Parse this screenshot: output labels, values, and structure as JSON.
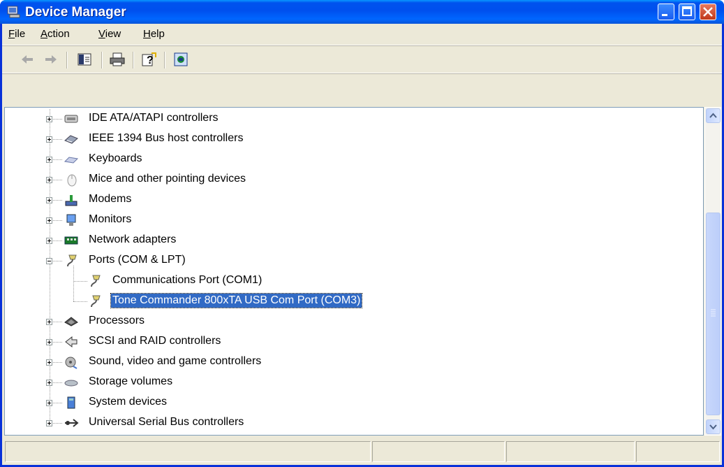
{
  "window": {
    "title": "Device Manager"
  },
  "menu": [
    {
      "label": "File",
      "u": "F",
      "rest": "ile"
    },
    {
      "label": "Action",
      "u": "A",
      "rest": "ction"
    },
    {
      "label": "View",
      "u": "V",
      "rest": "iew"
    },
    {
      "label": "Help",
      "u": "H",
      "rest": "elp"
    }
  ],
  "toolbar": {
    "buttons": [
      "back-icon",
      "forward-icon",
      "show-hide-tree-icon",
      "print-icon",
      "help-icon",
      "properties-icon"
    ]
  },
  "tree": {
    "items": [
      {
        "label": "IDE ATA/ATAPI controllers",
        "icon": "ide-controller-icon",
        "expanded": false
      },
      {
        "label": "IEEE 1394 Bus host controllers",
        "icon": "ieee1394-icon",
        "expanded": false
      },
      {
        "label": "Keyboards",
        "icon": "keyboard-icon",
        "expanded": false
      },
      {
        "label": "Mice and other pointing devices",
        "icon": "mouse-icon",
        "expanded": false
      },
      {
        "label": "Modems",
        "icon": "modem-icon",
        "expanded": false
      },
      {
        "label": "Monitors",
        "icon": "monitor-icon",
        "expanded": false
      },
      {
        "label": "Network adapters",
        "icon": "network-adapter-icon",
        "expanded": false
      },
      {
        "label": "Ports (COM & LPT)",
        "icon": "port-icon",
        "expanded": true,
        "children": [
          {
            "label": "Communications Port (COM1)",
            "icon": "port-icon",
            "selected": false
          },
          {
            "label": "Tone Commander 800xTA USB Com Port (COM3)",
            "icon": "port-icon",
            "selected": true
          }
        ]
      },
      {
        "label": "Processors",
        "icon": "processor-icon",
        "expanded": false
      },
      {
        "label": "SCSI and RAID controllers",
        "icon": "scsi-icon",
        "expanded": false
      },
      {
        "label": "Sound, video and game controllers",
        "icon": "sound-icon",
        "expanded": false
      },
      {
        "label": "Storage volumes",
        "icon": "storage-icon",
        "expanded": false
      },
      {
        "label": "System devices",
        "icon": "system-device-icon",
        "expanded": false
      },
      {
        "label": "Universal Serial Bus controllers",
        "icon": "usb-icon",
        "expanded": false
      }
    ]
  },
  "colors": {
    "selection": "#316ac5",
    "titlebar": "#0053ee"
  }
}
